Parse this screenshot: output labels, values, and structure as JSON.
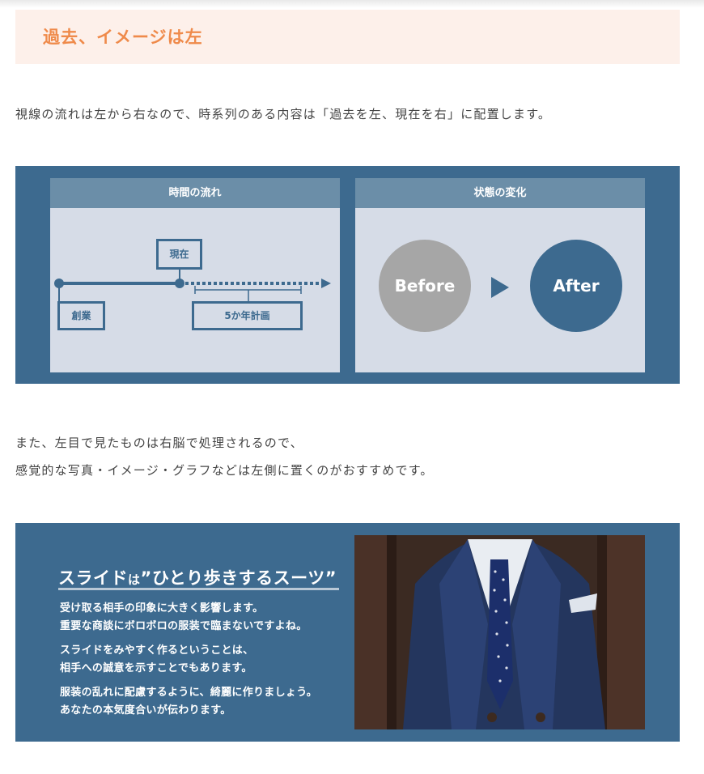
{
  "heading": "過去、イメージは左",
  "paragraph1": "視線の流れは左から右なので、時系列のある内容は「過去を左、現在を右」に配置します。",
  "figure1": {
    "timeline_panel": {
      "title": "時間の流れ",
      "current_label": "現在",
      "founding_label": "創業",
      "plan_label": "5か年計画"
    },
    "change_panel": {
      "title": "状態の変化",
      "before_label": "Before",
      "after_label": "After"
    }
  },
  "paragraph2_line1": "また、左目で見たものは右脳で処理されるので、",
  "paragraph2_line2": "感覚的な写真・イメージ・グラフなどは左側に置くのがおすすめです。",
  "figure2": {
    "title_part1": "スライド",
    "title_part2": "は",
    "title_part3": "”ひとり歩きするスーツ”",
    "lines": [
      "受け取る相手の印象に大きく影響します。",
      "重要な商談にボロボロの服装で臨まないですよね。",
      "スライドをみやすく作るということは、",
      "相手への誠意を示すことでもあります。",
      "服装の乱れに配慮するように、綺麗に作りましょう。",
      "あなたの本気度合いが伝わります。"
    ]
  },
  "colors": {
    "accent_orange": "#ef8a4a",
    "heading_bg": "#fdf0ea",
    "navy": "#3d6a8f",
    "panel_bg": "#d6dce7",
    "panel_header": "#6b8ea8",
    "before_gray": "#a6a6a6"
  }
}
